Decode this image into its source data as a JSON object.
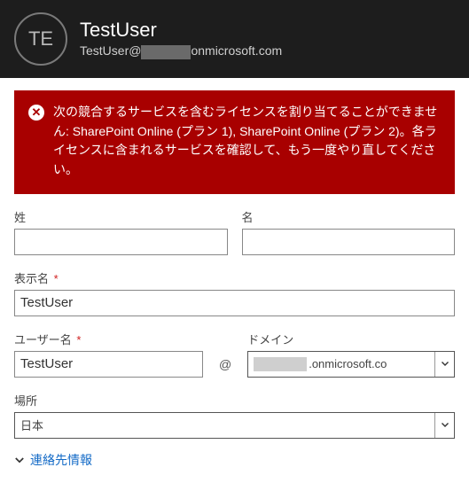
{
  "header": {
    "avatar_initials": "TE",
    "display_name": "TestUser",
    "email_prefix": "TestUser@",
    "email_domain_hidden": "xxxxxxxx",
    "email_suffix": "onmicrosoft.com"
  },
  "alert": {
    "message": "次の競合するサービスを含むライセンスを割り当てることができません: SharePoint Online (プラン 1), SharePoint Online (プラン 2)。各ライセンスに含まれるサービスを確認して、もう一度やり直してください。"
  },
  "form": {
    "last_name": {
      "label": "姓",
      "value": ""
    },
    "first_name": {
      "label": "名",
      "value": ""
    },
    "display_name": {
      "label": "表示名",
      "required": "*",
      "value": "TestUser"
    },
    "user_name": {
      "label": "ユーザー名",
      "required": "*",
      "value": "TestUser"
    },
    "at": "@",
    "domain": {
      "label": "ドメイン",
      "value_suffix": ".onmicrosoft.co"
    },
    "location": {
      "label": "場所",
      "value": "日本"
    }
  },
  "links": {
    "contact_info": "連絡先情報"
  }
}
